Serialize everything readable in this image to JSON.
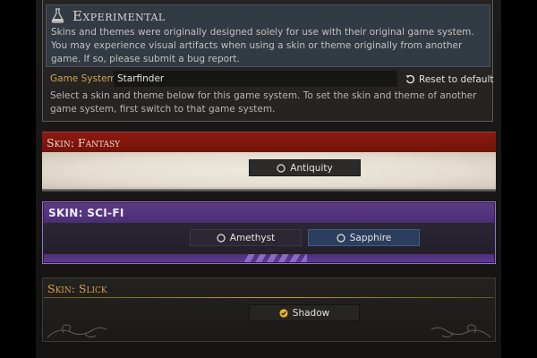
{
  "experimental": {
    "title": "Experimental",
    "icon": "flask-icon",
    "text": "Skins and themes were originally designed solely for use with their original game system. You may experience visual artifacts when using a skin or theme originally from another game. If so, please submit a bug report."
  },
  "game_system": {
    "label": "Game System",
    "value": "Starfinder",
    "reset_label": "Reset to default",
    "help_text": "Select a skin and theme below for this game system. To set the skin and theme of another game system, first switch to that game system."
  },
  "skins": {
    "fantasy": {
      "title": "Skin: Fantasy",
      "themes": [
        {
          "label": "Antiquity",
          "selected": false
        }
      ]
    },
    "scifi": {
      "title": "SKIN: SCI-FI",
      "themes": [
        {
          "label": "Amethyst",
          "selected": false
        },
        {
          "label": "Sapphire",
          "selected": false
        }
      ]
    },
    "slick": {
      "title": "Skin: Slick",
      "themes": [
        {
          "label": "Shadow",
          "selected": true
        }
      ]
    }
  },
  "colors": {
    "accent_gold": "#d5a14a",
    "fantasy_red": "#8c1a10",
    "scifi_purple": "#5c3a88",
    "sapphire_blue": "#2b3e5d"
  }
}
